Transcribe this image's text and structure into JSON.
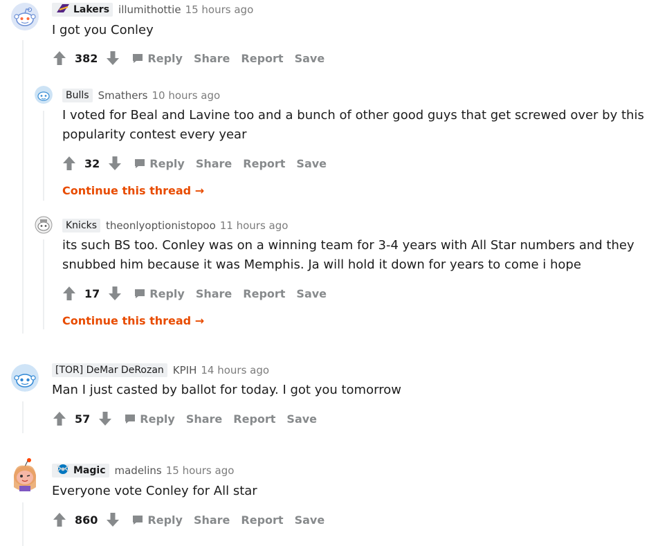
{
  "comments": [
    {
      "flair": "Lakers",
      "flair_icon": "lakers-logo-icon",
      "username": "illumithottie",
      "time": "15 hours ago",
      "body": "I got you Conley",
      "score": "382"
    },
    {
      "flair": "Bulls",
      "flair_icon": "bulls-logo-icon",
      "username": "Smathers",
      "time": "10 hours ago",
      "body_line1": "I voted for Beal and Lavine too and a bunch of other good guys that get screwed over by this",
      "body_line2": "popularity contest every year",
      "score": "32",
      "continue": "Continue this thread"
    },
    {
      "flair": "Knicks",
      "username": "theonlyoptionistopoo",
      "time": "11 hours ago",
      "body_line1": "its such BS too. Conley was on a winning team for 3-4 years with All Star numbers and they",
      "body_line2": "snubbed him because it was Memphis. Ja will hold it down for years to come i hope",
      "score": "17",
      "continue": "Continue this thread"
    },
    {
      "flair": "[TOR] DeMar DeRozan",
      "username": "KPIH",
      "time": "14 hours ago",
      "body": "Man I just casted by ballot for today. I got you tomorrow",
      "score": "57"
    },
    {
      "flair": "Magic",
      "flair_icon": "magic-logo-icon",
      "username": "madelins",
      "time": "15 hours ago",
      "body": "Everyone vote Conley for All star",
      "score": "860"
    }
  ],
  "actions": {
    "reply": "Reply",
    "share": "Share",
    "report": "Report",
    "save": "Save"
  },
  "colors": {
    "continue": "#e84b00",
    "action_gray": "#878a8c",
    "flair_bg": "#edeff1",
    "thread_line": "#edeff1"
  }
}
